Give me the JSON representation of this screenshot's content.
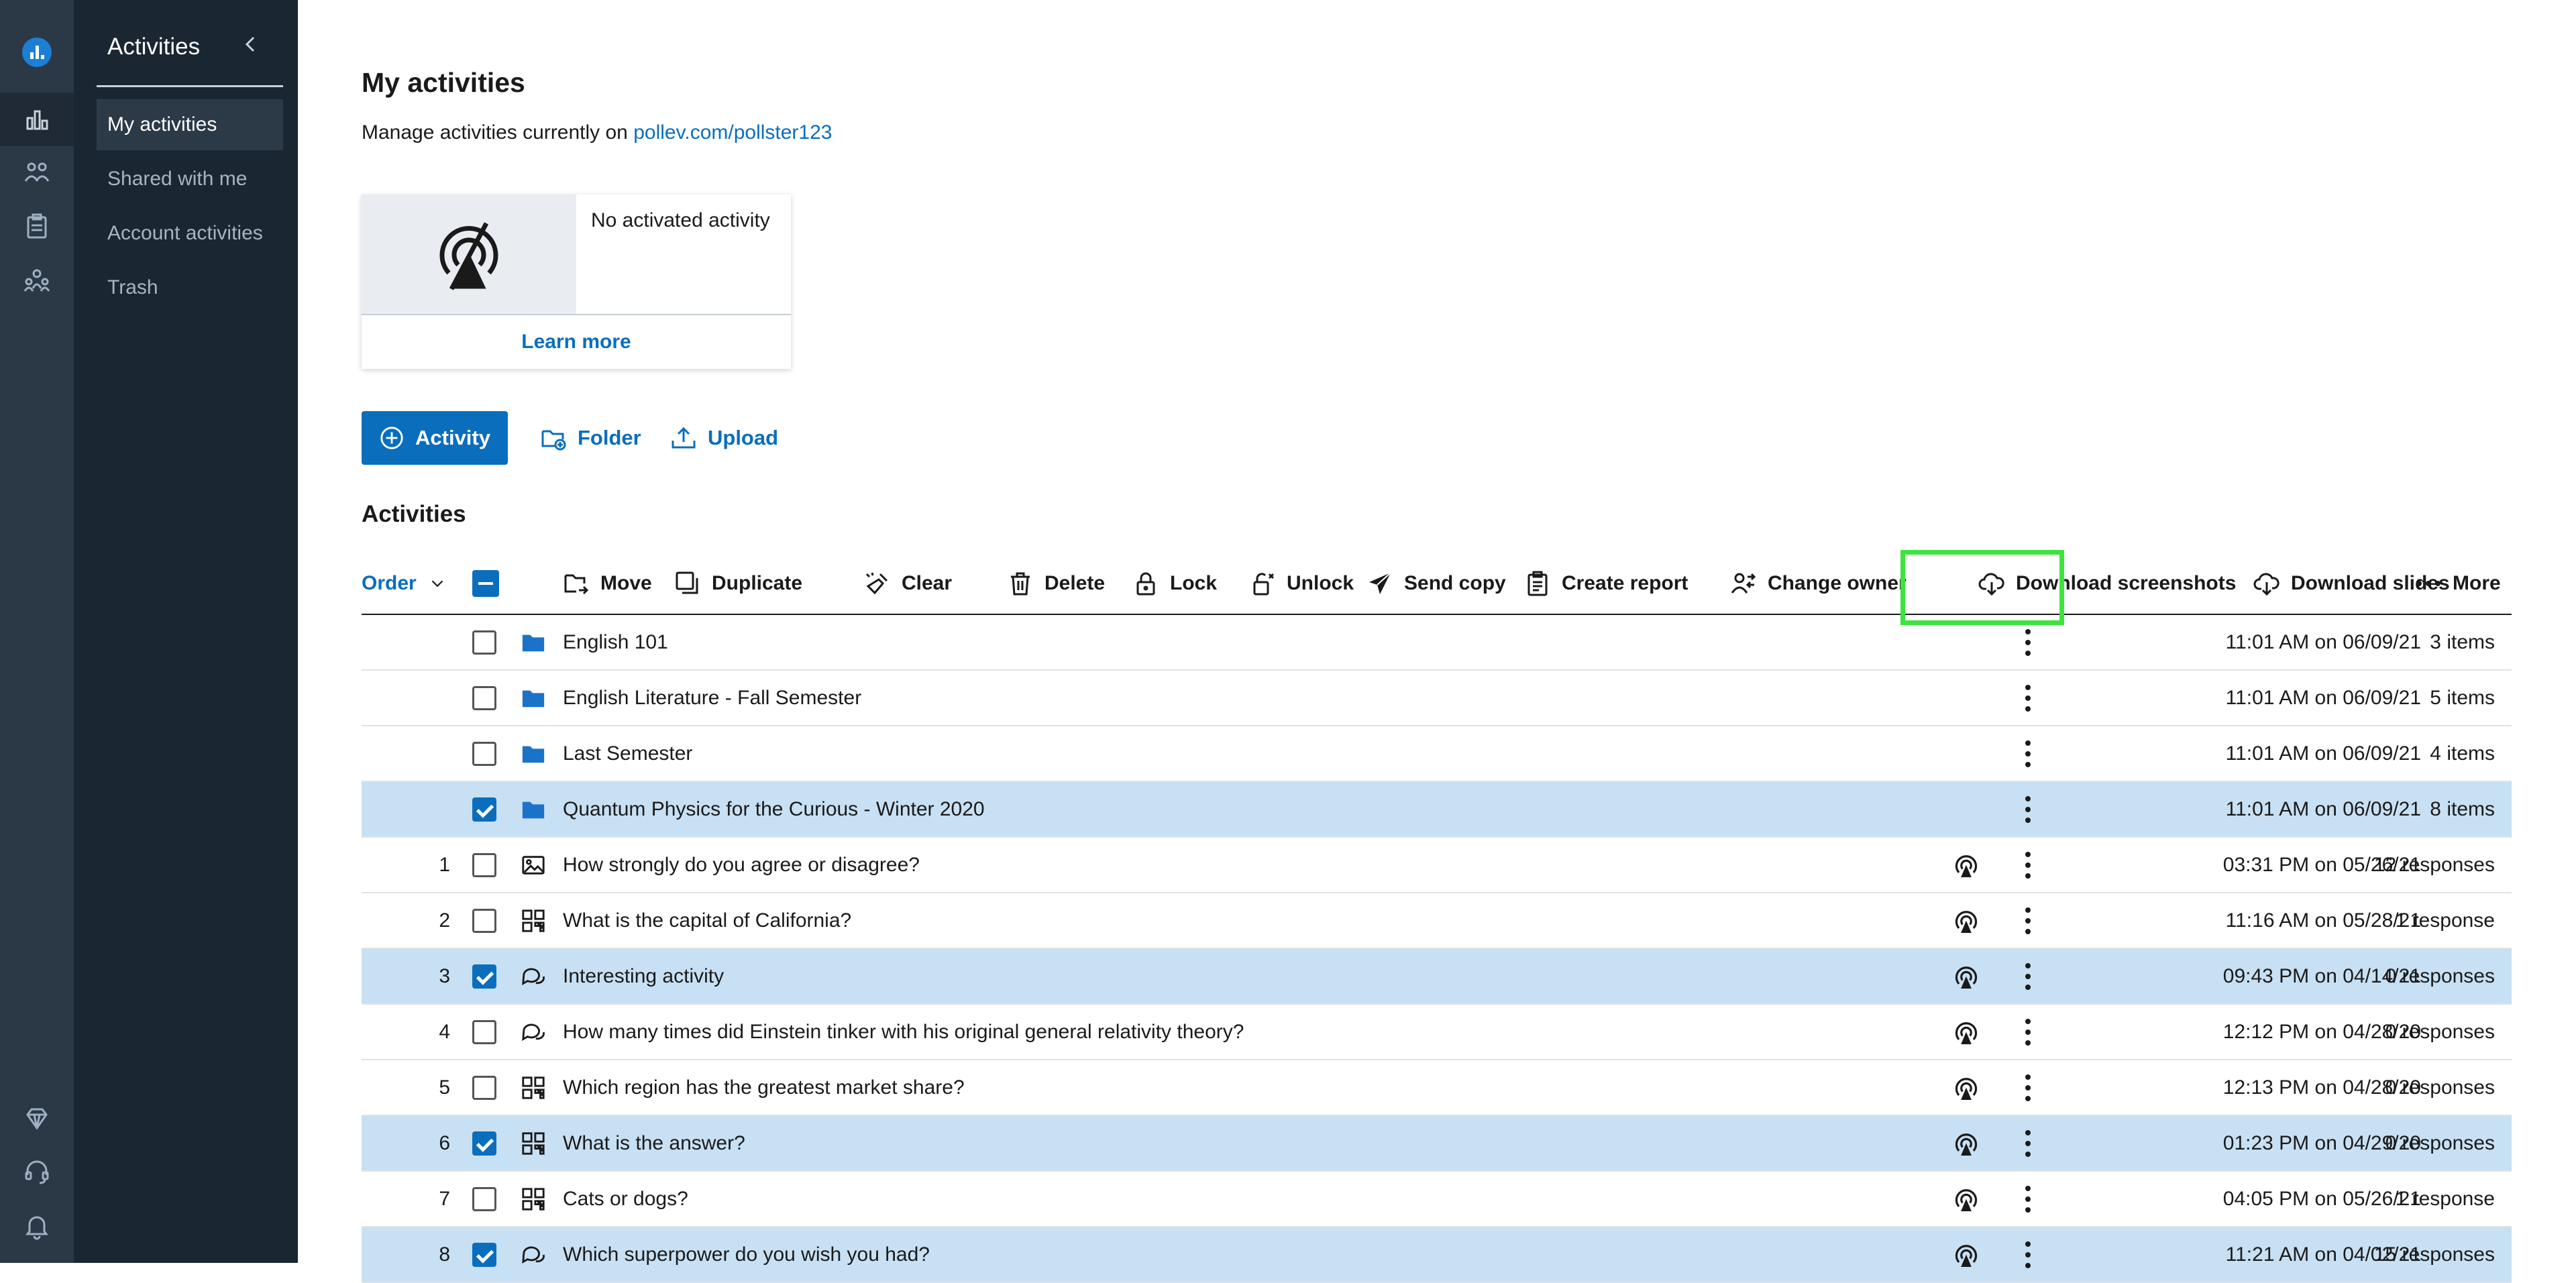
{
  "sidebar": {
    "title": "Activities",
    "items": [
      {
        "label": "My activities",
        "active": true
      },
      {
        "label": "Shared with me",
        "active": false
      },
      {
        "label": "Account activities",
        "active": false
      },
      {
        "label": "Trash",
        "active": false
      }
    ]
  },
  "rail": {
    "icons": [
      "logo-icon",
      "activities-icon",
      "participants-icon",
      "reports-icon",
      "groups-icon",
      "diamond-icon",
      "support-icon",
      "notifications-icon"
    ]
  },
  "main": {
    "title": "My activities",
    "manage_prefix": "Manage activities currently on ",
    "manage_link": "pollev.com/pollster123",
    "card": {
      "status": "No activated activity",
      "link": "Learn more"
    },
    "buttons": {
      "activity": "Activity",
      "folder": "Folder",
      "upload": "Upload"
    },
    "section_title": "Activities"
  },
  "toolbar": {
    "order": "Order",
    "move": "Move",
    "duplicate": "Duplicate",
    "clear": "Clear",
    "delete": "Delete",
    "lock": "Lock",
    "unlock": "Unlock",
    "send_copy": "Send copy",
    "create_report": "Create report",
    "change_owner": "Change owner",
    "download_screenshots": "Download screenshots",
    "download_slides": "Download slides",
    "more": "More"
  },
  "rows": [
    {
      "num": "",
      "type": "folder",
      "title": "English 101",
      "date": "11:01 AM on 06/09/21",
      "count": "3 items",
      "checked": false
    },
    {
      "num": "",
      "type": "folder",
      "title": "English Literature - Fall Semester",
      "date": "11:01 AM on 06/09/21",
      "count": "5 items",
      "checked": false
    },
    {
      "num": "",
      "type": "folder",
      "title": "Last Semester",
      "date": "11:01 AM on 06/09/21",
      "count": "4 items",
      "checked": false
    },
    {
      "num": "",
      "type": "folder",
      "title": "Quantum Physics for the Curious - Winter 2020",
      "date": "11:01 AM on 06/09/21",
      "count": "8 items",
      "checked": true
    },
    {
      "num": "1",
      "type": "image",
      "title": "How strongly do you agree or disagree?",
      "date": "03:31 PM on 05/26/21",
      "count": "12 responses",
      "checked": false
    },
    {
      "num": "2",
      "type": "grid",
      "title": "What is the capital of California?",
      "date": "11:16 AM on 05/28/21",
      "count": "1 response",
      "checked": false
    },
    {
      "num": "3",
      "type": "chat",
      "title": "Interesting activity",
      "date": "09:43 PM on 04/14/21",
      "count": "0 responses",
      "checked": true
    },
    {
      "num": "4",
      "type": "chat",
      "title": "How many times did Einstein tinker with his original general relativity theory?",
      "date": "12:12 PM on 04/28/20",
      "count": "0 responses",
      "checked": false
    },
    {
      "num": "5",
      "type": "grid",
      "title": "Which region has the greatest market share?",
      "date": "12:13 PM on 04/28/20",
      "count": "0 responses",
      "checked": false
    },
    {
      "num": "6",
      "type": "grid",
      "title": "What is the answer?",
      "date": "01:23 PM on 04/29/20",
      "count": "0 responses",
      "checked": true
    },
    {
      "num": "7",
      "type": "grid",
      "title": "Cats or dogs?",
      "date": "04:05 PM on 05/26/21",
      "count": "1 response",
      "checked": false
    },
    {
      "num": "8",
      "type": "chat",
      "title": "Which superpower do you wish you had?",
      "date": "11:21 AM on 04/02/21",
      "count": "15 responses",
      "checked": true
    }
  ]
}
